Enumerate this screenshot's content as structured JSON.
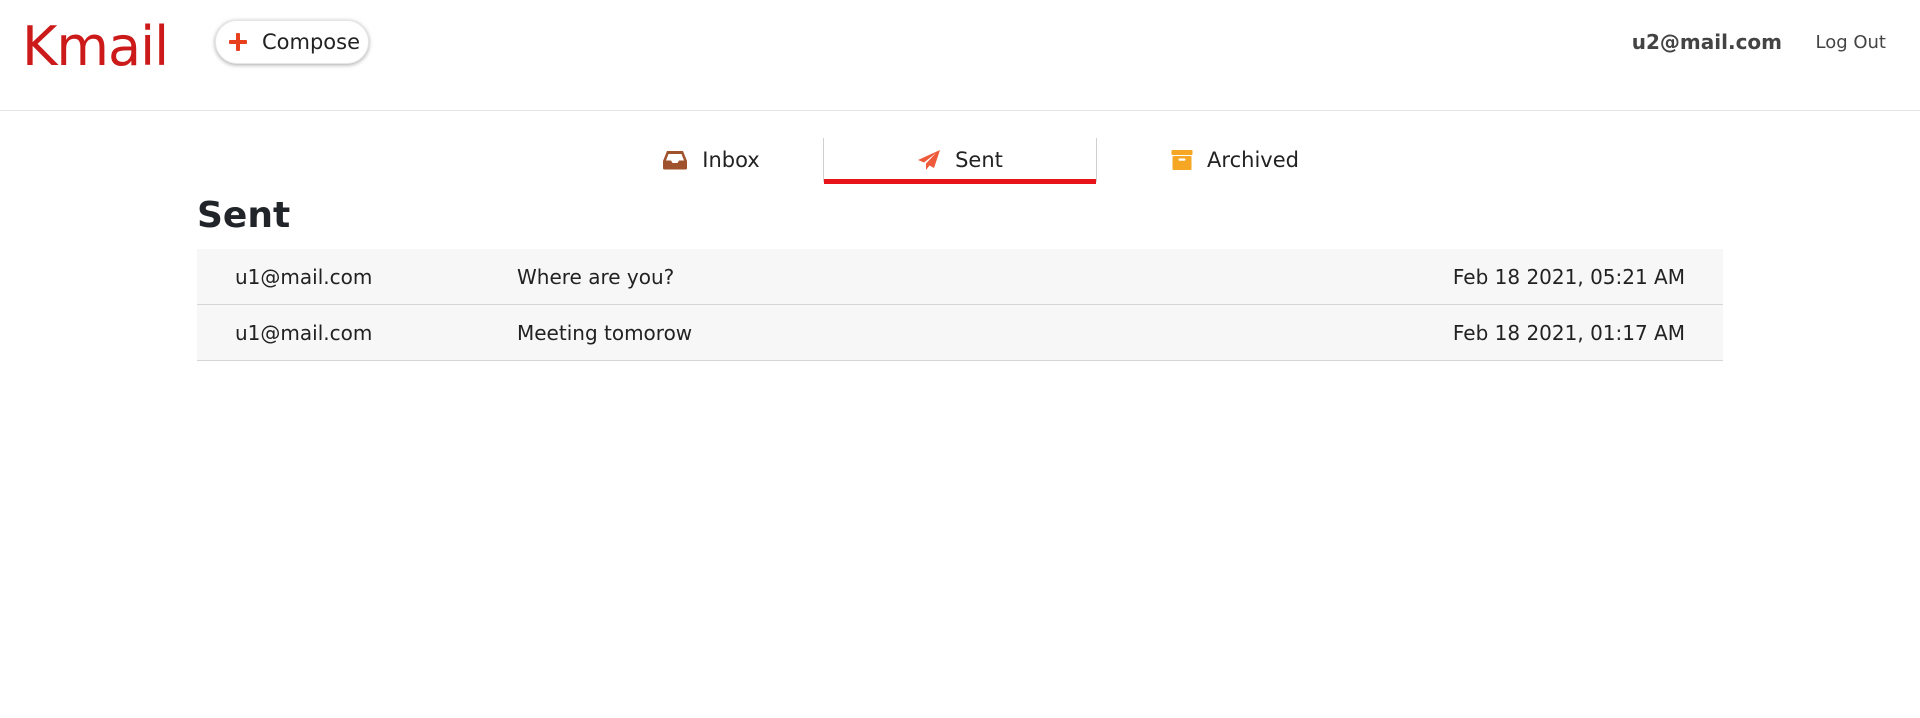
{
  "app": {
    "logo": "Kmail"
  },
  "header": {
    "compose_label": "Compose",
    "user_email": "u2@mail.com",
    "logout_label": "Log Out"
  },
  "tabs": [
    {
      "label": "Inbox",
      "icon": "inbox-icon",
      "active": false
    },
    {
      "label": "Sent",
      "icon": "paper-plane-icon",
      "active": true
    },
    {
      "label": "Archived",
      "icon": "archive-box-icon",
      "active": false
    }
  ],
  "main": {
    "title": "Sent",
    "emails": [
      {
        "to": "u1@mail.com",
        "subject": "Where are you?",
        "date": "Feb 18 2021, 05:21 AM"
      },
      {
        "to": "u1@mail.com",
        "subject": "Meeting tomorow",
        "date": "Feb 18 2021, 01:17 AM"
      }
    ]
  },
  "colors": {
    "brand": "#cc1a1a",
    "active_tab_underline": "#e8141b",
    "compose_plus": "#e8401c",
    "inbox_icon": "#a0522d",
    "sent_icon": "#ef5a3a",
    "archived_icon": "#f5a623"
  }
}
